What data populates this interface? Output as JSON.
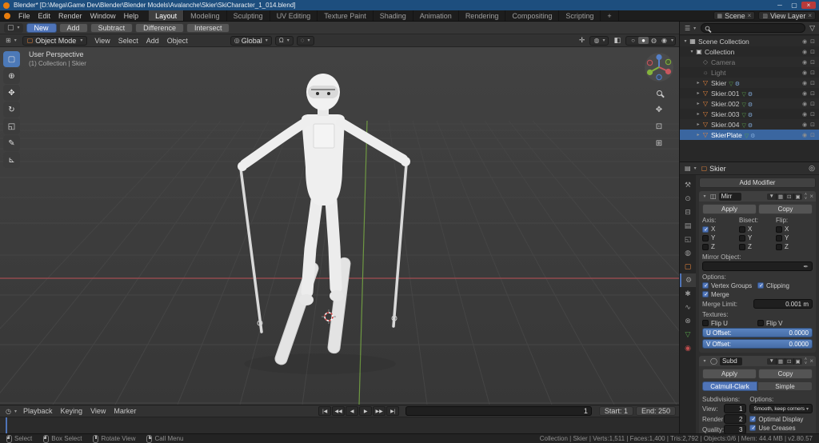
{
  "title_bar": {
    "app_title": "Blender* [D:\\Mega\\Game Dev\\Blender\\Blender Models\\Avalanche\\Skier\\SkiCharacter_1_014.blend]",
    "minimize": "─",
    "maximize": "▢",
    "close": "×"
  },
  "menu_bar": {
    "menus": [
      {
        "label": "File"
      },
      {
        "label": "Edit"
      },
      {
        "label": "Render"
      },
      {
        "label": "Window"
      },
      {
        "label": "Help"
      }
    ],
    "workspaces": [
      {
        "label": "Layout",
        "state": "active"
      },
      {
        "label": "Modeling"
      },
      {
        "label": "Sculpting"
      },
      {
        "label": "UV Editing"
      },
      {
        "label": "Texture Paint"
      },
      {
        "label": "Shading"
      },
      {
        "label": "Animation"
      },
      {
        "label": "Rendering"
      },
      {
        "label": "Compositing"
      },
      {
        "label": "Scripting"
      },
      {
        "label": "+"
      }
    ],
    "scene": {
      "label": "Scene"
    },
    "view_layer": {
      "label": "View Layer"
    }
  },
  "tool_settings": {
    "modes": [
      {
        "label": "New",
        "state": "active"
      },
      {
        "label": "Add"
      },
      {
        "label": "Subtract"
      },
      {
        "label": "Difference"
      },
      {
        "label": "Intersect"
      }
    ]
  },
  "viewport": {
    "header": {
      "mode": "Object Mode",
      "menus": [
        {
          "label": "View"
        },
        {
          "label": "Select"
        },
        {
          "label": "Add"
        },
        {
          "label": "Object"
        }
      ],
      "orientation": "Global"
    },
    "overlay": {
      "perspective": "User Perspective",
      "context": "(1) Collection | Skier"
    },
    "tools": [
      {
        "glyph": "▢",
        "title": "select-box",
        "state": "active"
      },
      {
        "glyph": "⊕",
        "title": "cursor"
      },
      {
        "glyph": "✥",
        "title": "move"
      },
      {
        "glyph": "↻",
        "title": "rotate"
      },
      {
        "glyph": "◱",
        "title": "scale"
      },
      {
        "glyph": "✎",
        "title": "annotate"
      },
      {
        "glyph": "⊾",
        "title": "measure"
      }
    ]
  },
  "outliner": {
    "rows": [
      {
        "label": "Scene Collection",
        "indent": "d0",
        "icon": "scene",
        "expander": "▾"
      },
      {
        "label": "Collection",
        "indent": "d1",
        "icon": "collection",
        "expander": "▾"
      },
      {
        "label": "Camera",
        "indent": "d2",
        "icon": "camera",
        "state": "dimmed"
      },
      {
        "label": "Light",
        "indent": "d2",
        "icon": "light",
        "state": "dimmed"
      },
      {
        "label": "Skier",
        "indent": "d2",
        "icon": "mesh",
        "expander": "▸",
        "extras": "hasdata"
      },
      {
        "label": "Skier.001",
        "indent": "d2",
        "icon": "mesh",
        "expander": "▸",
        "extras": "hasdata"
      },
      {
        "label": "Skier.002",
        "indent": "d2",
        "icon": "mesh",
        "expander": "▸",
        "extras": "hasdata"
      },
      {
        "label": "Skier.003",
        "indent": "d2",
        "icon": "mesh",
        "expander": "▸",
        "extras": "hasdata"
      },
      {
        "label": "Skier.004",
        "indent": "d2",
        "icon": "mesh",
        "expander": "▸",
        "extras": "hasdata"
      },
      {
        "label": "SkierPlate",
        "indent": "d2",
        "icon": "mesh",
        "expander": "▸",
        "extras": "hasdata",
        "state": "selected"
      }
    ]
  },
  "properties": {
    "breadcrumb_object": "Skier",
    "add_modifier_label": "Add Modifier",
    "tabs": [
      {
        "name": "tool",
        "glyph": "⚒"
      },
      {
        "name": "render",
        "glyph": "⊙"
      },
      {
        "name": "output",
        "glyph": "⊟"
      },
      {
        "name": "view-layer",
        "glyph": "▤"
      },
      {
        "name": "scene",
        "glyph": "◱"
      },
      {
        "name": "world",
        "glyph": "◍"
      },
      {
        "name": "object",
        "glyph": "▢",
        "tint": "c-orange"
      },
      {
        "name": "modifiers",
        "glyph": "⚙",
        "state": "active"
      },
      {
        "name": "particles",
        "glyph": "✱"
      },
      {
        "name": "physics",
        "glyph": "∿"
      },
      {
        "name": "constraints",
        "glyph": "⊗"
      },
      {
        "name": "object-data",
        "glyph": "▽",
        "tint": "c-green"
      },
      {
        "name": "material",
        "glyph": "◉",
        "tint": "c-red"
      }
    ],
    "mirror": {
      "name": "Mirr",
      "apply": "Apply",
      "copy": "Copy",
      "axis_label": "Axis:",
      "bisect_label": "Bisect:",
      "flip_label": "Flip:",
      "axes": [
        {
          "label": "X",
          "axis": "on"
        },
        {
          "label": "Y"
        },
        {
          "label": "Z"
        }
      ],
      "mirror_object_label": "Mirror Object:",
      "options_label": "Options:",
      "vertex_groups": "Vertex Groups",
      "clipping": "Clipping",
      "merge": "Merge",
      "merge_limit_label": "Merge Limit:",
      "merge_limit": "0.001 m",
      "textures_label": "Textures:",
      "flip_u": "Flip U",
      "flip_v": "Flip V",
      "u_offset_label": "U Offset:",
      "u_offset": "0.0000",
      "v_offset_label": "V Offset:",
      "v_offset": "0.0000"
    },
    "subsurf": {
      "name": "Subd",
      "apply": "Apply",
      "copy": "Copy",
      "catmull": "Catmull-Clark",
      "simple": "Simple",
      "subdivisions_label": "Subdivisions:",
      "options_label": "Options:",
      "view_label": "View:",
      "view": "1",
      "render_label": "Render:",
      "render": "2",
      "quality_label": "Quality:",
      "quality": "3",
      "uv_smooth": "Smooth, keep corners",
      "optimal_display": "Optimal Display",
      "use_creases": "Use Creases"
    }
  },
  "timeline": {
    "menus": [
      "Playback",
      "Keying",
      "View",
      "Marker"
    ],
    "transport": [
      {
        "glyph": "|◀",
        "name": "jump-to-start"
      },
      {
        "glyph": "◀◀",
        "name": "previous-keyframe"
      },
      {
        "glyph": "◀",
        "name": "play-reverse"
      },
      {
        "glyph": "▶",
        "name": "play"
      },
      {
        "glyph": "▶▶",
        "name": "next-keyframe"
      },
      {
        "glyph": "▶|",
        "name": "jump-to-end"
      }
    ],
    "current_frame": "1",
    "start_label": "Start:",
    "start": "1",
    "end_label": "End:",
    "end": "250"
  },
  "status_bar": {
    "hints": [
      {
        "label": "Select",
        "btn": "l"
      },
      {
        "label": "Box Select",
        "btn": "l"
      },
      {
        "label": "Rotate View",
        "btn": "m"
      },
      {
        "label": "Call Menu",
        "btn": "r"
      }
    ],
    "stats": "Collection | Skier | Verts:1,511 | Faces:1,400 | Tris:2,792 | Objects:0/6 | Mem: 44.4 MB | v2.80.57"
  },
  "icons": {
    "caret": "▾",
    "caret_right": "▸",
    "close": "×",
    "editor_3d": "⊞",
    "editor_outliner": "☰",
    "editor_props": "▤",
    "editor_timeline": "◷",
    "object_mode": "▢",
    "globe": "◎",
    "magnet": "Ω",
    "proportional": "◌",
    "gizmo": "✛",
    "overlays": "◍",
    "xray": "◧",
    "shade_wire": "○",
    "shade_solid": "●",
    "shade_material": "◍",
    "shade_rendered": "◉",
    "eye": "◉",
    "render_cam": "⊡",
    "funnel": "▽",
    "pin": "◎",
    "eyedropper": "✒",
    "pan": "✥",
    "camera_view": "⊡",
    "ortho": "⊞",
    "scene_w": "▦",
    "viewlayer_w": "▥",
    "tool_cursor": "▢",
    "mod_mirror": "◫",
    "mod_subsurf": "◯",
    "tog1": "▼",
    "tog2": "▦",
    "tog3": "⊡",
    "tog4": "▣",
    "panel_up": "∧",
    "panel_down": "∨"
  },
  "accent_colors": {
    "selection_blue": "#4f74b8",
    "object_orange": "#e8853c",
    "axis_red": "#a24d52",
    "axis_green": "#6e9842",
    "titlebar_blue": "#1d4e7e"
  }
}
